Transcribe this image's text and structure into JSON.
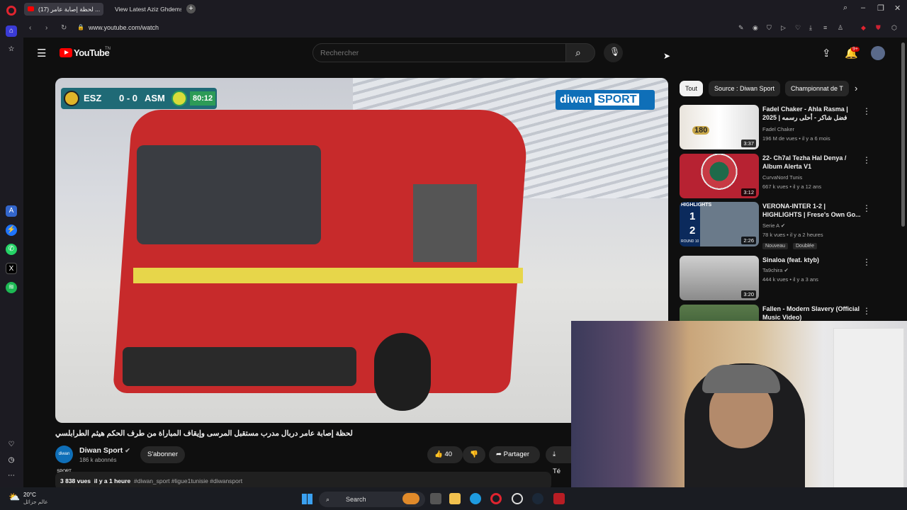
{
  "browser": {
    "tabs": [
      {
        "label": "(17) لحظة إصابة عامر ..."
      },
      {
        "label": "View Latest Aziz Ghdemsi"
      }
    ],
    "url": "www.youtube.com/watch"
  },
  "youtube": {
    "logo_text": "YouTube",
    "country": "TN",
    "search_placeholder": "Rechercher",
    "notif_count": "9+"
  },
  "video": {
    "overlay": {
      "team1": "ESZ",
      "score": "0 - 0",
      "team2": "ASM",
      "time": "80:12",
      "brand1": "diwan",
      "brand2": "SPORT"
    },
    "title": "لحظة إصابة عامر دربال مدرب مستقبل المرسى وإيقاف المباراة من طرف الحكم هيثم الطرابلسي",
    "channel": {
      "name": "Diwan Sport",
      "subs": "186 k abonnés",
      "avatar_text": "diwan SPORT",
      "subscribe": "S'abonner"
    },
    "likes": "40",
    "share": "Partager",
    "download": "Té",
    "views": "3 838 vues",
    "age": "il y a 1 heure",
    "tags": "#diwan_sport #ligue1tunisie #diwansport"
  },
  "chips": [
    "Tout",
    "Source : Diwan Sport",
    "Championnat de T"
  ],
  "recommendations": [
    {
      "title": "Fadel Chaker - Ahla Rasma | فضل شاكر - أحلى رسمه | 2025",
      "channel": "Fadel Chaker",
      "meta": "196 M de vues • il y a 6 mois",
      "duration": "3:37",
      "thumb_text": "180"
    },
    {
      "title": "22- Ch7al Tezha Hal Denya / Album Alerta V1",
      "channel": "CurvaNord Tunis",
      "meta": "667 k vues • il y a 12 ans",
      "duration": "3:12"
    },
    {
      "title": "VERONA-INTER 1-2 | HIGHLIGHTS | Frese's Own Go...",
      "channel": "Serie A",
      "meta": "78 k vues • il y a 2 heures",
      "duration": "2:26",
      "badge1": "Nouveau",
      "badge2": "Doublée",
      "thumb_text": "HIGHLIGHTS",
      "thumb_score1": "1",
      "thumb_score2": "2",
      "thumb_round": "ROUND 10"
    },
    {
      "title": "Sinaloa (feat. ktyb)",
      "channel": "Ta9chira",
      "meta": "444 k vues • il y a 3 ans",
      "duration": "3:20"
    },
    {
      "title": "Fallen - Modern Slavery (Official Music Video)",
      "channel": "",
      "meta": "",
      "duration": ""
    }
  ],
  "taskbar": {
    "temp": "20°C",
    "weather_desc": "عالم جزائل",
    "search": "Search"
  },
  "colors": {
    "accent": "#ff0000",
    "bg": "#0f0f0f",
    "diwan_blue": "#0f6fb8"
  }
}
